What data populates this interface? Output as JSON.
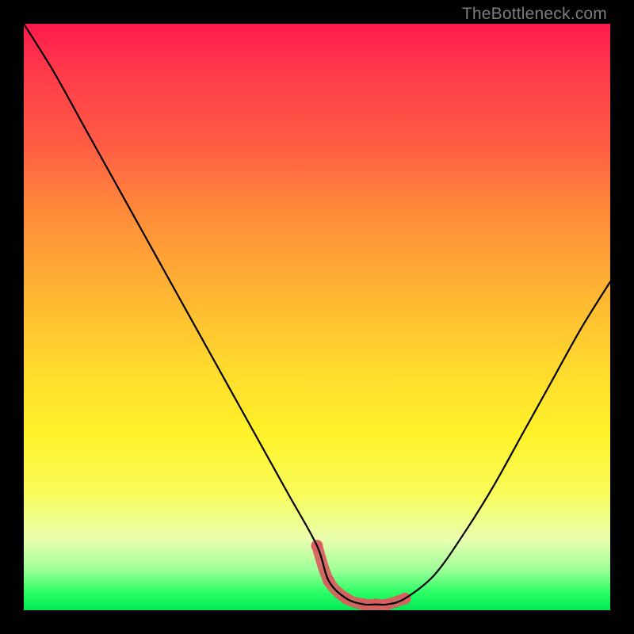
{
  "watermark": "TheBottleneck.com",
  "chart_data": {
    "type": "line",
    "title": "",
    "xlabel": "",
    "ylabel": "",
    "xlim": [
      0,
      100
    ],
    "ylim": [
      0,
      100
    ],
    "series": [
      {
        "name": "bottleneck-curve",
        "x": [
          0,
          5,
          10,
          15,
          20,
          25,
          30,
          35,
          40,
          45,
          50,
          52,
          55,
          58,
          60,
          62,
          65,
          70,
          75,
          80,
          85,
          90,
          95,
          100
        ],
        "y": [
          100,
          92,
          83,
          74,
          65,
          56,
          47,
          38,
          29,
          20,
          11,
          5,
          2,
          1,
          1,
          1,
          2,
          6,
          13,
          21,
          30,
          39,
          48,
          56
        ]
      }
    ],
    "annotations": [
      {
        "name": "optimal-region",
        "x_start": 52,
        "x_end": 65,
        "color": "#d86060"
      }
    ]
  }
}
